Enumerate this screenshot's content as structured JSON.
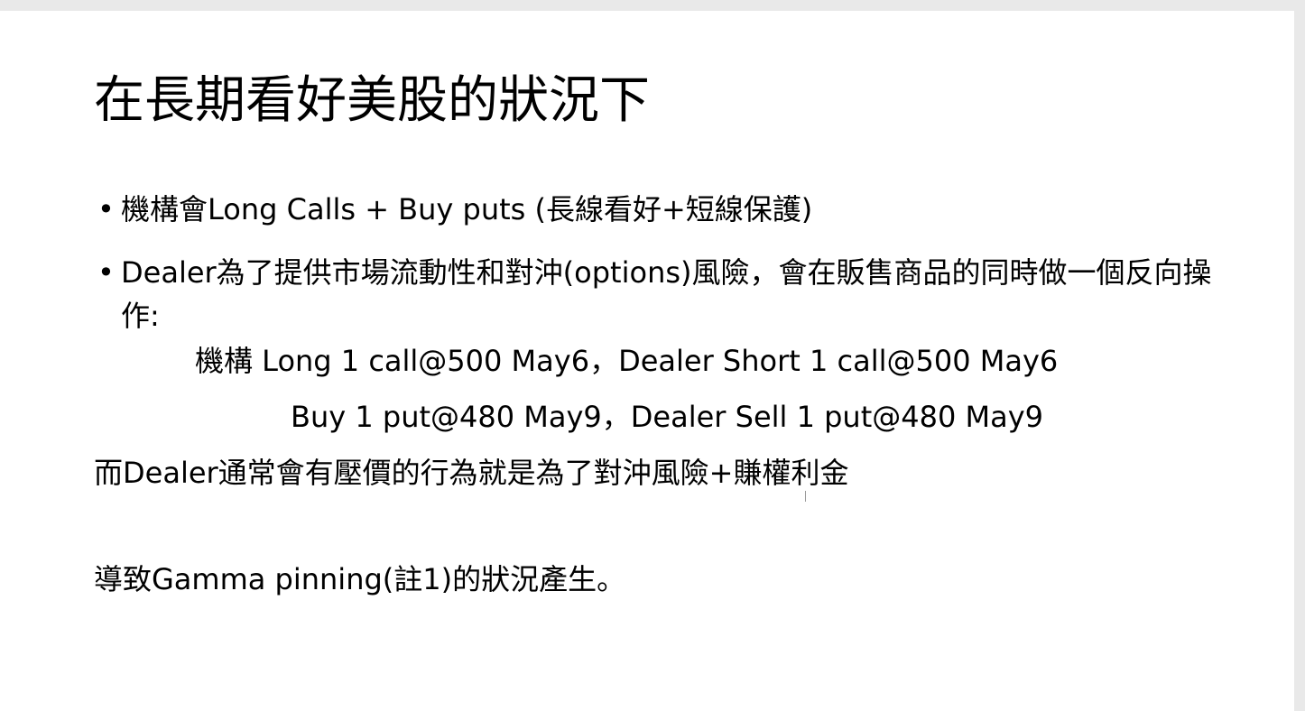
{
  "slide": {
    "title": "在長期看好美股的狀況下",
    "bullets": [
      "機構會Long Calls + Buy puts (長線看好+短線保護)",
      "Dealer為了提供市場流動性和對沖(options)風險，會在販售商品的同時做一個反向操作:"
    ],
    "trades": [
      "機構 Long 1 call@500 May6，Dealer Short 1 call@500 May6",
      "Buy 1 put@480 May9，Dealer Sell 1 put@480 May9"
    ],
    "notes": [
      "而Dealer通常會有壓價的行為就是為了對沖風險+賺權利金",
      "導致Gamma pinning(註1)的狀況產生。"
    ]
  }
}
